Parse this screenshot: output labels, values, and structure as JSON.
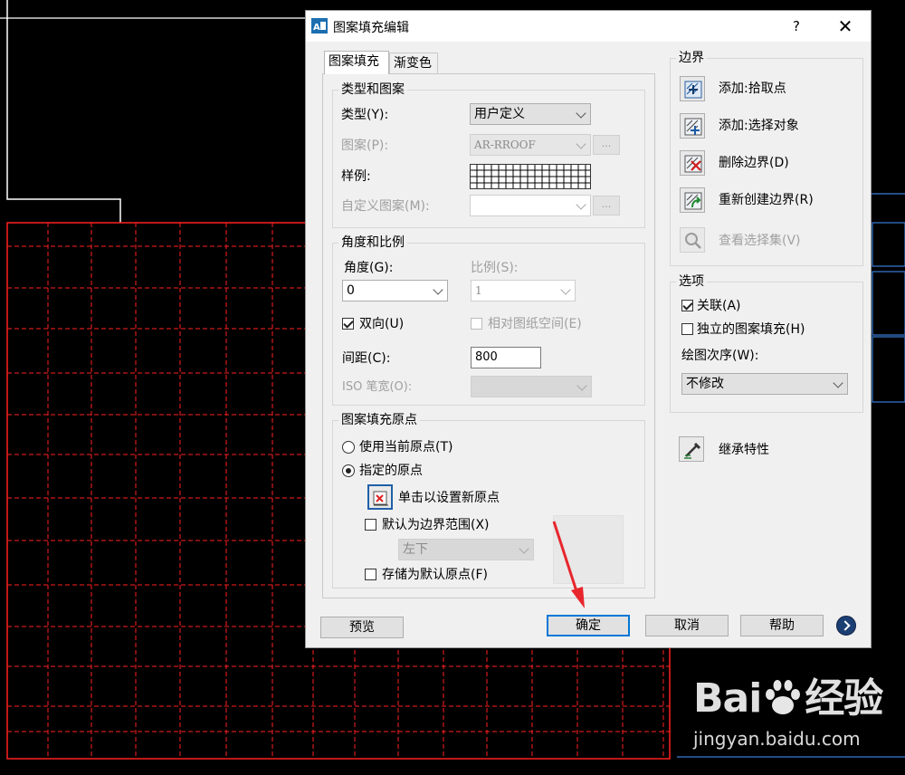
{
  "dialog": {
    "title": "图案填充编辑",
    "help_glyph": "?",
    "close_glyph": "✕"
  },
  "tabs": {
    "hatch": "图案填充",
    "gradient": "渐变色"
  },
  "type_pattern": {
    "legend": "类型和图案",
    "type_label": "类型(Y):",
    "type_value": "用户定义",
    "pattern_label": "图案(P):",
    "pattern_value": "AR-RROOF",
    "swatch_label": "样例:",
    "custom_label": "自定义图案(M):",
    "dots": "..."
  },
  "angle_scale": {
    "legend": "角度和比例",
    "angle_label": "角度(G):",
    "angle_value": "0",
    "scale_label": "比例(S):",
    "scale_value": "1",
    "double_label": "双向(U)",
    "double_checked": true,
    "relative_label": "相对图纸空间(E)",
    "spacing_label": "间距(C):",
    "spacing_value": "800",
    "iso_label": "ISO 笔宽(O):"
  },
  "origin": {
    "legend": "图案填充原点",
    "use_current_label": "使用当前原点(T)",
    "specified_label": "指定的原点",
    "click_set_label": "单击以设置新原点",
    "default_extent_label": "默认为边界范围(X)",
    "extent_value": "左下",
    "store_default_label": "存储为默认原点(F)"
  },
  "boundary": {
    "legend": "边界",
    "add_pick_label": "添加:拾取点",
    "add_select_label": "添加:选择对象",
    "remove_label": "删除边界(D)",
    "recreate_label": "重新创建边界(R)",
    "view_label": "查看选择集(V)"
  },
  "options": {
    "legend": "选项",
    "associative_label": "关联(A)",
    "associative_checked": true,
    "separate_label": "独立的图案填充(H)",
    "draw_order_label": "绘图次序(W):",
    "draw_order_value": "不修改"
  },
  "inherit_label": "继承特性",
  "footer": {
    "preview": "预览",
    "ok": "确定",
    "cancel": "取消",
    "help": "帮助"
  },
  "watermark": {
    "brand": "Bai",
    "brand_cn": "经验",
    "url": "jingyan.baidu.com"
  },
  "colors": {
    "hatch_line": "#ff2020",
    "cad_line": "#ffffff",
    "blue_line": "#3a7bd5",
    "annotation_arrow": "#e8262d"
  }
}
